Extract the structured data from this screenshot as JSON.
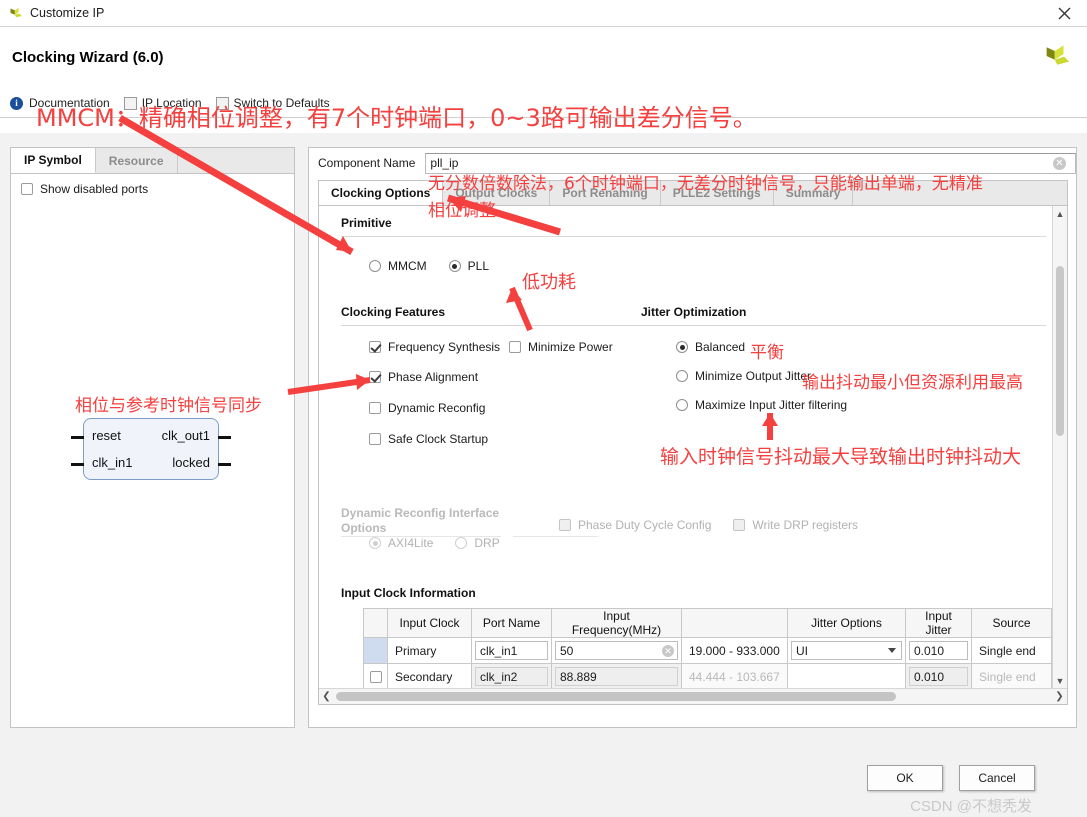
{
  "window": {
    "title": "Customize IP",
    "close_icon": "close-icon",
    "app_icon": "xilinx-logo-icon"
  },
  "header": {
    "title": "Clocking Wizard (6.0)",
    "logo_icon": "xilinx-logo-icon"
  },
  "toolbar": {
    "info_icon": "info-icon",
    "items": [
      {
        "label": "Documentation",
        "icon": "documentation-icon"
      },
      {
        "label": "IP Location",
        "icon": "ip-location-icon"
      },
      {
        "label": "Switch to Defaults",
        "icon": "switch-defaults-icon"
      }
    ]
  },
  "left_panel": {
    "tabs": [
      {
        "label": "IP Symbol",
        "active": true
      },
      {
        "label": "Resource",
        "active": false
      }
    ],
    "show_disabled_ports": {
      "label": "Show disabled ports",
      "checked": false
    },
    "symbol": {
      "left_ports": [
        "reset",
        "clk_in1"
      ],
      "right_ports": [
        "clk_out1",
        "locked"
      ]
    }
  },
  "right_panel": {
    "component_name": {
      "label": "Component Name",
      "value": "pll_ip",
      "clear_icon": "clear-icon"
    },
    "tabs": [
      {
        "label": "Clocking Options",
        "active": true
      },
      {
        "label": "Output Clocks",
        "active": false
      },
      {
        "label": "Port Renaming",
        "active": false
      },
      {
        "label": "PLLE2 Settings",
        "active": false
      },
      {
        "label": "Summary",
        "active": false
      }
    ],
    "primitive": {
      "title": "Primitive",
      "options": [
        {
          "label": "MMCM",
          "selected": false
        },
        {
          "label": "PLL",
          "selected": true
        }
      ]
    },
    "clocking_features": {
      "title": "Clocking Features",
      "items": [
        {
          "label": "Frequency Synthesis",
          "checked": true
        },
        {
          "label": "Minimize Power",
          "checked": false
        },
        {
          "label": "Phase Alignment",
          "checked": true
        },
        {
          "label": "Dynamic Reconfig",
          "checked": false
        },
        {
          "label": "Safe Clock Startup",
          "checked": false
        }
      ]
    },
    "jitter_optimization": {
      "title": "Jitter Optimization",
      "options": [
        {
          "label": "Balanced",
          "selected": true
        },
        {
          "label": "Minimize Output Jitter",
          "selected": false
        },
        {
          "label": "Maximize Input Jitter filtering",
          "selected": false
        }
      ]
    },
    "dynamic_reconfig": {
      "title_line1": "Dynamic Reconfig Interface",
      "title_line2": "Options",
      "radios": [
        {
          "label": "AXI4Lite",
          "selected": true
        },
        {
          "label": "DRP",
          "selected": false
        }
      ],
      "checks": [
        {
          "label": "Phase Duty Cycle Config",
          "checked": false
        },
        {
          "label": "Write DRP registers",
          "checked": false
        }
      ]
    },
    "input_clock_information": {
      "title": "Input Clock Information",
      "columns": [
        "",
        "Input Clock",
        "Port Name",
        "Input Frequency(MHz)",
        "",
        "Jitter Options",
        "Input Jitter",
        "Source"
      ],
      "rows": [
        {
          "enabled": true,
          "input_clock": "Primary",
          "port_name": "clk_in1",
          "input_frequency": "50",
          "range": "19.000 - 933.000",
          "jitter_options": "UI",
          "input_jitter": "0.010",
          "source": "Single end"
        },
        {
          "enabled": false,
          "input_clock": "Secondary",
          "port_name": "clk_in2",
          "input_frequency": "88.889",
          "range": "44.444 - 103.667",
          "jitter_options": "",
          "input_jitter": "0.010",
          "source": "Single end"
        }
      ]
    }
  },
  "footer": {
    "ok_label": "OK",
    "cancel_label": "Cancel",
    "watermark": "CSDN @不想秃发"
  },
  "annotations": [
    {
      "id": "a1",
      "text": "MMCM：精确相位调整，有7个时钟端口，0~3路可输出差分信号。"
    },
    {
      "id": "a2",
      "text": "无分数倍数除法，6个时钟端口，无差分时钟信号，只能输出单端，无精准"
    },
    {
      "id": "a3",
      "text": "相位调整"
    },
    {
      "id": "a4",
      "text": "低功耗"
    },
    {
      "id": "a5",
      "text": "平衡"
    },
    {
      "id": "a6",
      "text": "输出抖动最小但资源利用最高"
    },
    {
      "id": "a7",
      "text": "输入时钟信号抖动最大导致输出时钟抖动大"
    },
    {
      "id": "a8",
      "text": "相位与参考时钟信号同步"
    }
  ],
  "colors": {
    "annotation_red": "#f4403f",
    "accent_blue": "#1b4f9c",
    "logo_green": "#c8d430"
  }
}
